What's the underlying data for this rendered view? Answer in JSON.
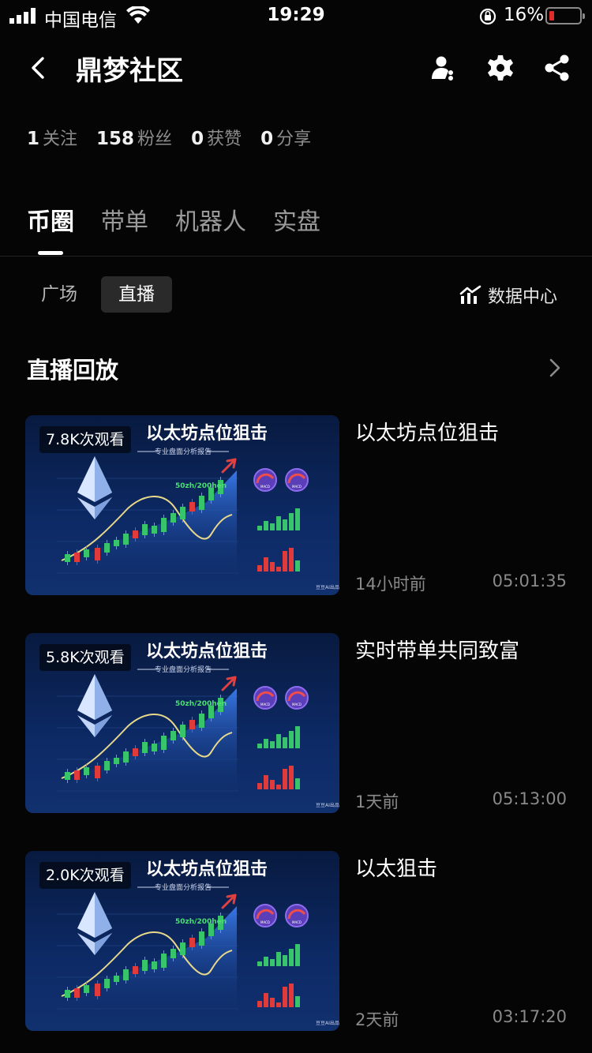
{
  "status_bar": {
    "carrier": "中国电信",
    "time": "19:29",
    "battery": "16%"
  },
  "nav": {
    "title": "鼎梦社区",
    "icons": [
      "back-icon",
      "user-follow-icon",
      "gear-icon",
      "share-icon"
    ]
  },
  "stats": [
    {
      "num": "1",
      "label": "关注"
    },
    {
      "num": "158",
      "label": "粉丝"
    },
    {
      "num": "0",
      "label": "获赞"
    },
    {
      "num": "0",
      "label": "分享"
    }
  ],
  "tabs": [
    {
      "label": "币圈",
      "active": true
    },
    {
      "label": "带单",
      "active": false
    },
    {
      "label": "机器人",
      "active": false
    },
    {
      "label": "实盘",
      "active": false
    }
  ],
  "sub_tabs": [
    {
      "label": "广场",
      "active": false
    },
    {
      "label": "直播",
      "active": true
    }
  ],
  "data_center": {
    "label": "数据中心",
    "icon": "chart-icon"
  },
  "section": {
    "title": "直播回放"
  },
  "thumbnail": {
    "heading": "以太坊点位狙击",
    "subheading": "专业盘面分析报告",
    "ma_label": "50zh/200hen",
    "gauge_label": "MACD",
    "watermark": "豆豆AI出品",
    "colors": {
      "up": "#37c46a",
      "down": "#e03a3a",
      "area": "#2a63d4",
      "curve": "#e8d98a"
    }
  },
  "videos": [
    {
      "views": "7.8K次观看",
      "title": "以太坊点位狙击",
      "ago": "14小时前",
      "duration": "05:01:35"
    },
    {
      "views": "5.8K次观看",
      "title": "实时带单共同致富",
      "ago": "1天前",
      "duration": "05:13:00"
    },
    {
      "views": "2.0K次观看",
      "title": "以太狙击",
      "ago": "2天前",
      "duration": "03:17:20"
    }
  ]
}
